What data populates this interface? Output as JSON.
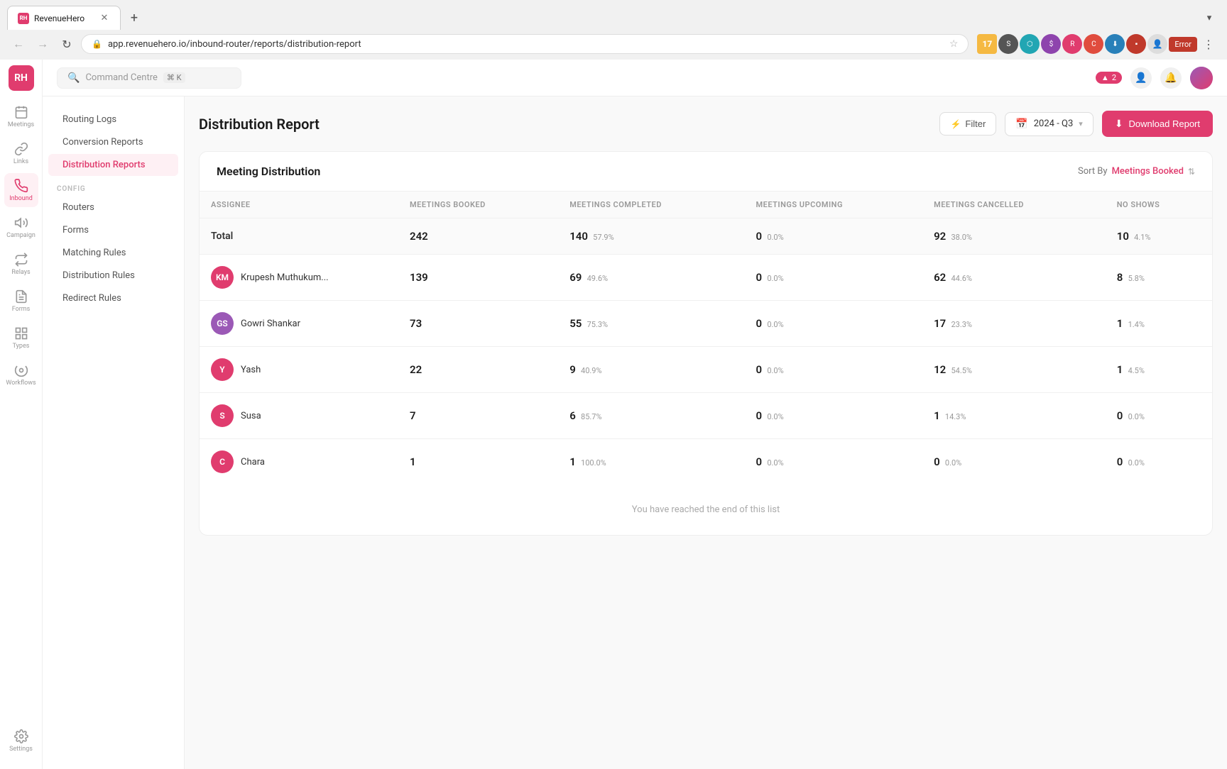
{
  "browser": {
    "tab_title": "RevenueHero",
    "tab_favicon": "RH",
    "address": "app.revenuehero.io/inbound-router/reports/distribution-report",
    "new_tab_icon": "+",
    "nav_back": "←",
    "nav_forward": "→",
    "nav_reload": "↻"
  },
  "topbar": {
    "search_placeholder": "Command Centre",
    "search_shortcut": "⌘ K",
    "alert_count": "2",
    "alert_icon": "▲"
  },
  "icon_sidebar": {
    "logo": "RH",
    "items": [
      {
        "icon": "meetings",
        "label": "Meetings",
        "active": false
      },
      {
        "icon": "links",
        "label": "Links",
        "active": false
      },
      {
        "icon": "inbound",
        "label": "Inbound",
        "active": true
      },
      {
        "icon": "campaign",
        "label": "Campaign",
        "active": false
      },
      {
        "icon": "relays",
        "label": "Relays",
        "active": false
      },
      {
        "icon": "forms",
        "label": "Forms",
        "active": false
      },
      {
        "icon": "types",
        "label": "Types",
        "active": false
      },
      {
        "icon": "workflows",
        "label": "Workflows",
        "active": false
      }
    ],
    "bottom_items": [
      {
        "icon": "settings",
        "label": "Settings"
      }
    ]
  },
  "nav_sidebar": {
    "items": [
      {
        "label": "Routing Logs",
        "active": false
      },
      {
        "label": "Conversion Reports",
        "active": false
      },
      {
        "label": "Distribution Reports",
        "active": true
      }
    ],
    "config_section": "CONFIG",
    "config_items": [
      {
        "label": "Routers",
        "active": false
      },
      {
        "label": "Forms",
        "active": false
      },
      {
        "label": "Matching Rules",
        "active": false
      },
      {
        "label": "Distribution Rules",
        "active": false
      },
      {
        "label": "Redirect Rules",
        "active": false
      }
    ]
  },
  "page": {
    "title": "Distribution Report",
    "filter_label": "Filter",
    "date_period": "2024 - Q3",
    "download_label": "Download Report"
  },
  "table": {
    "section_title": "Meeting Distribution",
    "sort_by_label": "Sort By",
    "sort_by_value": "Meetings Booked",
    "columns": [
      {
        "key": "assignee",
        "label": "ASSIGNEE"
      },
      {
        "key": "booked",
        "label": "MEETINGS BOOKED"
      },
      {
        "key": "completed",
        "label": "MEETINGS COMPLETED"
      },
      {
        "key": "upcoming",
        "label": "MEETINGS UPCOMING"
      },
      {
        "key": "cancelled",
        "label": "MEETINGS CANCELLED"
      },
      {
        "key": "noshows",
        "label": "NO SHOWS"
      }
    ],
    "total_row": {
      "label": "Total",
      "booked": "242",
      "completed": "140",
      "completed_pct": "57.9%",
      "upcoming": "0",
      "upcoming_pct": "0.0%",
      "cancelled": "92",
      "cancelled_pct": "38.0%",
      "noshows": "10",
      "noshows_pct": "4.1%"
    },
    "rows": [
      {
        "initials": "KM",
        "name": "Krupesh Muthukum...",
        "avatar_color": "#e03c6e",
        "booked": "139",
        "completed": "69",
        "completed_pct": "49.6%",
        "upcoming": "0",
        "upcoming_pct": "0.0%",
        "cancelled": "62",
        "cancelled_pct": "44.6%",
        "noshows": "8",
        "noshows_pct": "5.8%"
      },
      {
        "initials": "GS",
        "name": "Gowri Shankar",
        "avatar_color": "#9b59b6",
        "booked": "73",
        "completed": "55",
        "completed_pct": "75.3%",
        "upcoming": "0",
        "upcoming_pct": "0.0%",
        "cancelled": "17",
        "cancelled_pct": "23.3%",
        "noshows": "1",
        "noshows_pct": "1.4%"
      },
      {
        "initials": "Y",
        "name": "Yash",
        "avatar_color": "#e03c6e",
        "booked": "22",
        "completed": "9",
        "completed_pct": "40.9%",
        "upcoming": "0",
        "upcoming_pct": "0.0%",
        "cancelled": "12",
        "cancelled_pct": "54.5%",
        "noshows": "1",
        "noshows_pct": "4.5%"
      },
      {
        "initials": "S",
        "name": "Susa",
        "avatar_color": "#e03c6e",
        "booked": "7",
        "completed": "6",
        "completed_pct": "85.7%",
        "upcoming": "0",
        "upcoming_pct": "0.0%",
        "cancelled": "1",
        "cancelled_pct": "14.3%",
        "noshows": "0",
        "noshows_pct": "0.0%"
      },
      {
        "initials": "C",
        "name": "Chara",
        "avatar_color": "#e03c6e",
        "booked": "1",
        "completed": "1",
        "completed_pct": "100.0%",
        "upcoming": "0",
        "upcoming_pct": "0.0%",
        "cancelled": "0",
        "cancelled_pct": "0.0%",
        "noshows": "0",
        "noshows_pct": "0.0%"
      }
    ],
    "end_message": "You have reached the end of this list"
  }
}
